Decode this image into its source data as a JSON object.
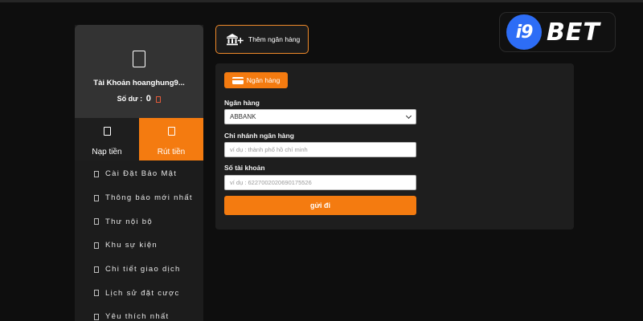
{
  "brand": {
    "logo_mark": "i9",
    "logo_text": "BET",
    "accent_color": "#f47b10",
    "logo_color": "#2d6df6"
  },
  "account": {
    "avatar_icon": "user-icon",
    "name": "Tài Khoản hoanghung9...",
    "balance_label": "Số dư :",
    "balance_value": "0"
  },
  "transactions": [
    {
      "label": "Nạp tiền",
      "icon": "deposit-icon",
      "active": false
    },
    {
      "label": "Rút tiền",
      "icon": "withdraw-icon",
      "active": true
    }
  ],
  "menu": [
    {
      "label": "Cài Đặt Bảo Mật"
    },
    {
      "label": "Thông báo mới nhất"
    },
    {
      "label": "Thư nội bộ"
    },
    {
      "label": "Khu sự kiện"
    },
    {
      "label": "Chi tiết giao dịch"
    },
    {
      "label": "Lịch sử đặt cược"
    },
    {
      "label": "Yêu thích nhất"
    }
  ],
  "add_bank_button": {
    "label": "Thêm ngân hàng",
    "icon": "bank-add-icon"
  },
  "form": {
    "tab_label": "Ngân hàng",
    "tab_icon": "card-icon",
    "bank": {
      "label": "Ngân hàng",
      "value": "ABBANK"
    },
    "branch": {
      "label": "Chi nhánh ngân hàng",
      "placeholder": "ví dụ : thành phố hồ chí minh"
    },
    "account_number": {
      "label": "Số tài khoản",
      "placeholder": "ví dụ : 6227002020690175526"
    },
    "submit_label": "gửi đi"
  }
}
